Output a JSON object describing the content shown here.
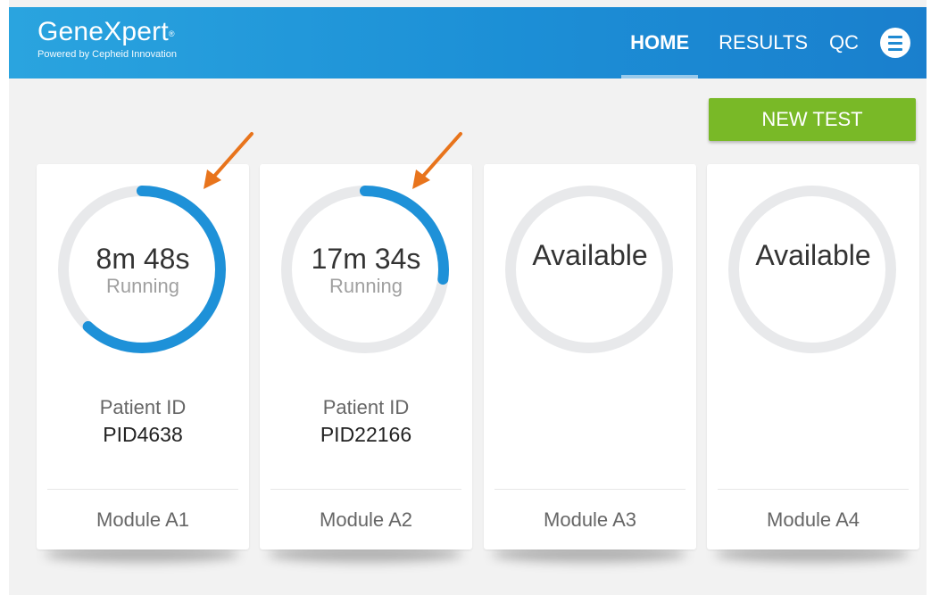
{
  "header": {
    "brand": "GeneXpert",
    "brand_mark": "®",
    "tagline": "Powered by Cepheid Innovation",
    "nav": [
      "HOME",
      "RESULTS",
      "QC"
    ],
    "menu_icon": "hamburger-menu-icon",
    "gradient_start": "#2aa4df",
    "gradient_end": "#1a7fcd"
  },
  "actions": {
    "new_test": "NEW TEST",
    "new_test_color": "#79b927"
  },
  "modules": [
    {
      "status": "running",
      "time": "8m 48s",
      "status_label": "Running",
      "patient_label": "Patient ID",
      "patient_id": "PID4638",
      "module": "Module A1",
      "progress": 0.62
    },
    {
      "status": "running",
      "time": "17m 34s",
      "status_label": "Running",
      "patient_label": "Patient ID",
      "patient_id": "PID22166",
      "module": "Module A2",
      "progress": 0.27
    },
    {
      "status": "available",
      "status_label": "Available",
      "module": "Module A3"
    },
    {
      "status": "available",
      "status_label": "Available",
      "module": "Module A4"
    }
  ],
  "colors": {
    "ring_track": "#e8e9eb",
    "ring_progress": "#1e91d8",
    "annotation_arrow": "#e8741c"
  }
}
